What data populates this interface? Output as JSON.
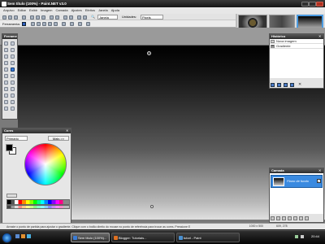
{
  "titlebar": {
    "title": "Sem título (100%) - Paint.NET v3.0"
  },
  "menu": [
    "Arquivo",
    "Editar",
    "Exibir",
    "Imagem",
    "Camada",
    "Ajustes",
    "Efeitos",
    "Janela",
    "Ajuda"
  ],
  "toolbar": {
    "zoom_value": "Janela",
    "units_label": "Unidades:",
    "units_value": "Pixels",
    "tool_label": "Ferramenta:"
  },
  "tools_panel": {
    "title": "Ferrame"
  },
  "history_panel": {
    "title": "Histórico",
    "items": [
      "Nova imagem",
      "Gradiente"
    ]
  },
  "layers_panel": {
    "title": "Camada",
    "layer_name": "Plano de fundo"
  },
  "colors_panel": {
    "title": "Cores",
    "mode": "Primário",
    "more_button": "Mais >>"
  },
  "status": {
    "hint": "Arraste o ponto de partida para ajustar o gradiente. Clique com o botão direito do mouse no ponto de referência para trocar as cores. Pressione E",
    "size": "1000 x 500",
    "coords": "609, 278"
  },
  "taskbar": {
    "tasks": [
      {
        "label": "Sem título (100%)...",
        "active": true,
        "color": "#3a7bd5"
      },
      {
        "label": "Blogger: Tutoriais...",
        "active": false,
        "color": "#e07020"
      },
      {
        "label": "tutori - Paint",
        "active": false,
        "color": "#4a90d0"
      }
    ],
    "clock": "20:44"
  }
}
